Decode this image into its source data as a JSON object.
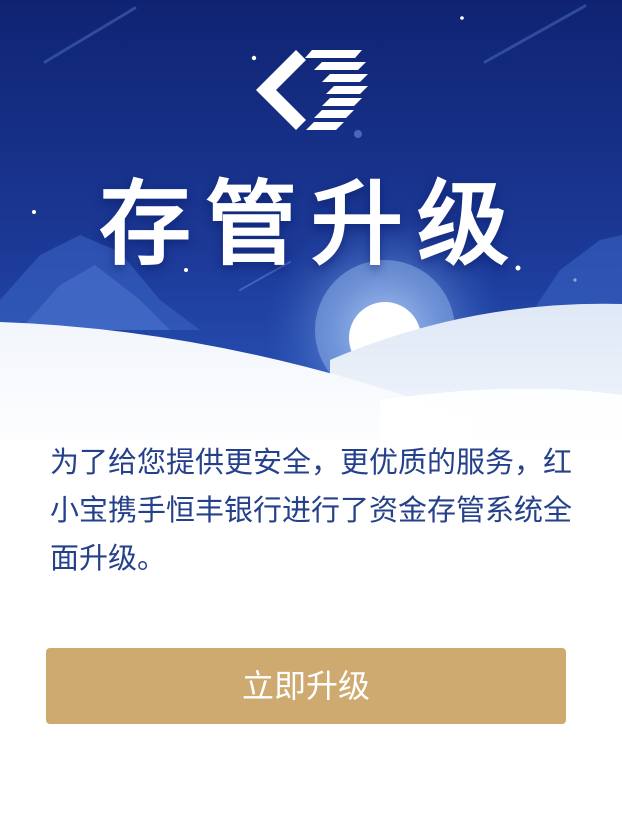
{
  "banner": {
    "title": "存管升级",
    "logo_icon": "bank-diamond-logo-icon"
  },
  "message": {
    "text": "为了给您提供更安全，更优质的服务，红小宝携手恒丰银行进行了资金存管系统全面升级。"
  },
  "actions": {
    "upgrade_label": "立即升级"
  },
  "colors": {
    "banner_top": "#0f2372",
    "banner_bottom": "#2a58c0",
    "text": "#26418b",
    "button": "#cfaa70"
  }
}
